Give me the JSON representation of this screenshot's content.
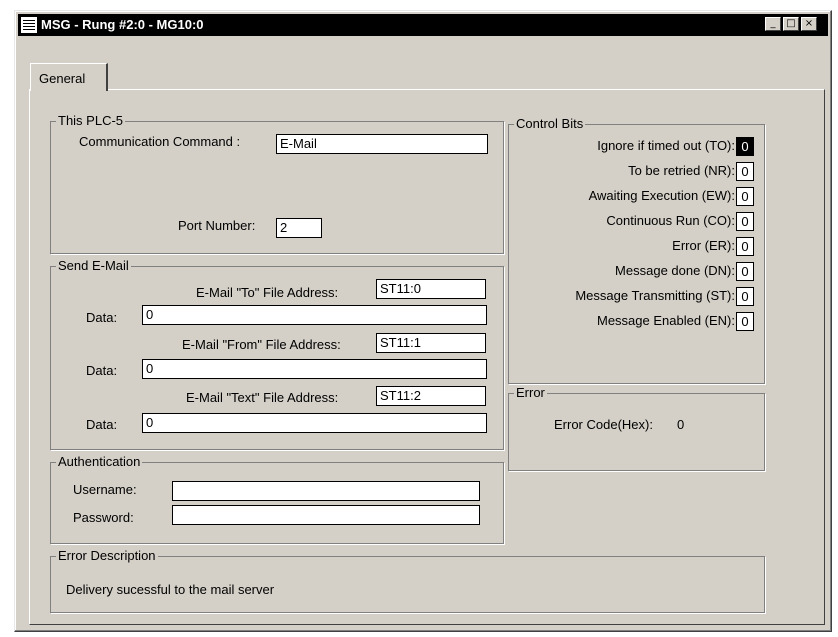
{
  "window": {
    "title": "MSG - Rung #2:0 - MG10:0"
  },
  "titlebar": {
    "minimize": "_",
    "maximize": "□",
    "close": "×"
  },
  "tabs": [
    {
      "label": "General"
    }
  ],
  "this_plc": {
    "legend": "This PLC-5",
    "command_label": "Communication Command :",
    "command_value": "E-Mail",
    "port_label": "Port Number:",
    "port_value": "2"
  },
  "send_email": {
    "legend": "Send E-Mail",
    "to_label": "E-Mail \"To\" File Address:",
    "to_value": "ST11:0",
    "from_label": "E-Mail \"From\" File Address:",
    "from_value": "ST11:1",
    "text_label": "E-Mail \"Text\" File Address:",
    "text_value": "ST11:2",
    "data_label": "Data:",
    "to_data": "0",
    "from_data": "0",
    "text_data": "0"
  },
  "authentication": {
    "legend": "Authentication",
    "username_label": "Username:",
    "username_value": "",
    "password_label": "Password:",
    "password_value": ""
  },
  "control_bits": {
    "legend": "Control Bits",
    "items": [
      {
        "label": "Ignore if timed out (TO):",
        "value": "0"
      },
      {
        "label": "To be retried (NR):",
        "value": "0"
      },
      {
        "label": "Awaiting Execution (EW):",
        "value": "0"
      },
      {
        "label": "Continuous Run (CO):",
        "value": "0"
      },
      {
        "label": "Error (ER):",
        "value": "0"
      },
      {
        "label": "Message done (DN):",
        "value": "0"
      },
      {
        "label": "Message Transmitting (ST):",
        "value": "0"
      },
      {
        "label": "Message Enabled (EN):",
        "value": "0"
      }
    ]
  },
  "error": {
    "legend": "Error",
    "code_label": "Error Code(Hex):",
    "code_value": "0"
  },
  "error_description": {
    "legend": "Error Description",
    "text": "Delivery sucessful to the mail server"
  }
}
